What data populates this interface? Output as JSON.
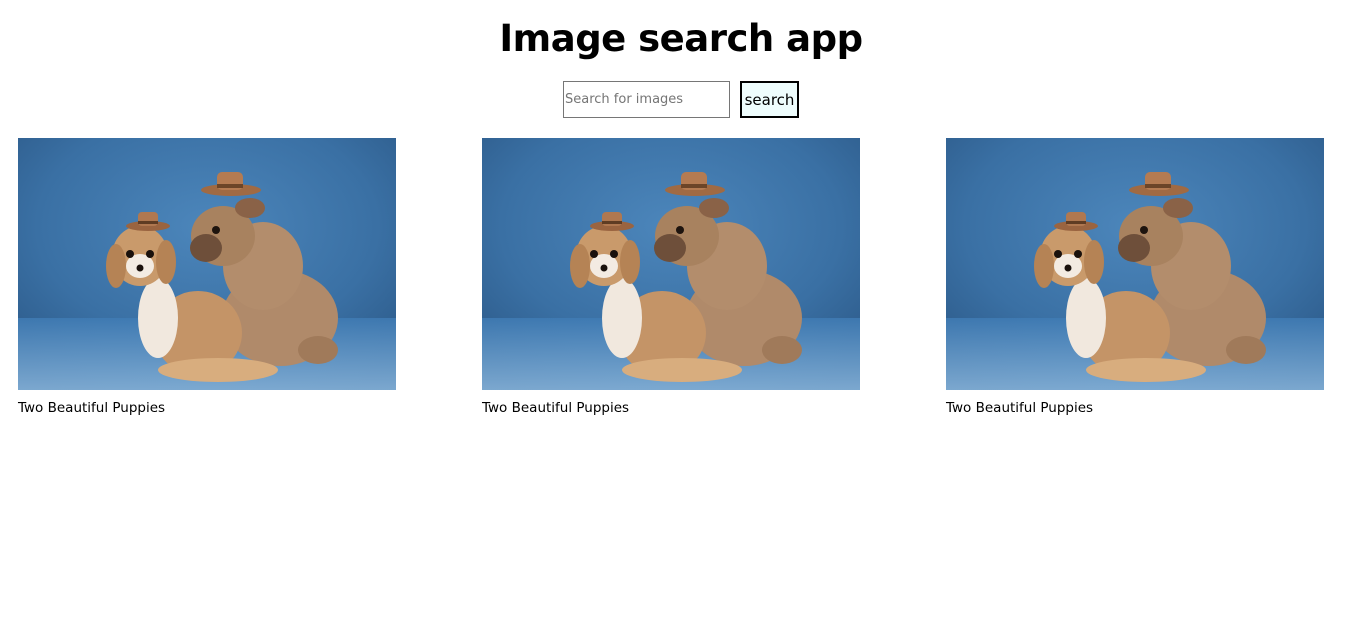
{
  "header": {
    "title": "Image search app"
  },
  "search": {
    "placeholder": "Search for images",
    "value": "",
    "button_label": "search"
  },
  "results": [
    {
      "caption": "Two Beautiful Puppies"
    },
    {
      "caption": "Two Beautiful Puppies"
    },
    {
      "caption": "Two Beautiful Puppies"
    }
  ],
  "colors": {
    "photo_background": "#3a73a8",
    "button_background": "#eefdfd"
  }
}
